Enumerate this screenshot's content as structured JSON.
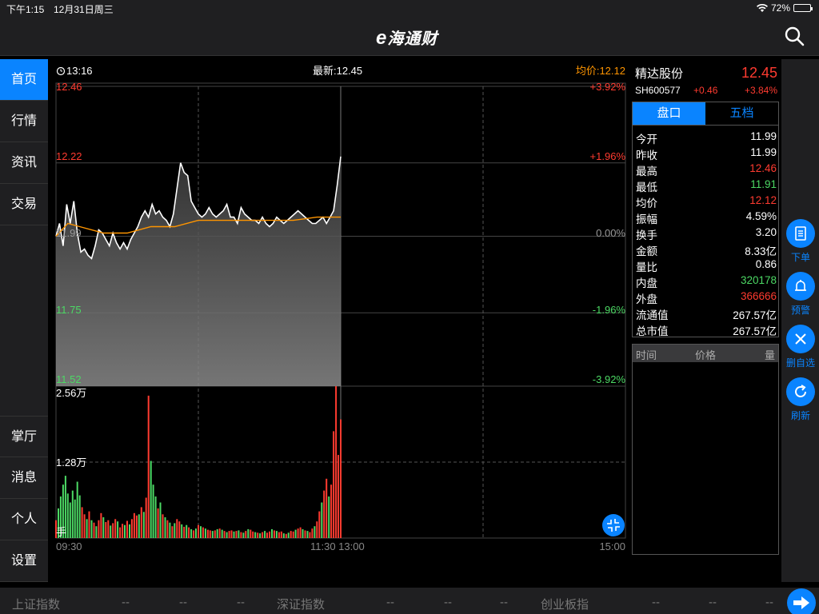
{
  "status_bar": {
    "time": "下午1:15",
    "date": "12月31日周三",
    "battery": "72%",
    "battery_level": 0.72
  },
  "header": {
    "logo_e": "e",
    "logo_text": "海通财"
  },
  "sidebar": {
    "items": [
      {
        "label": "首页",
        "active": true
      },
      {
        "label": "行情"
      },
      {
        "label": "资讯"
      },
      {
        "label": "交易"
      },
      {
        "label": "掌厅"
      },
      {
        "label": "消息"
      },
      {
        "label": "个人"
      },
      {
        "label": "设置"
      }
    ]
  },
  "chart_header": {
    "clock_time": "13:16",
    "latest": "最新:12.45",
    "average": "均价:12.12"
  },
  "chart_data": {
    "type": "line",
    "price_axis_left": [
      "12.46",
      "12.22",
      "11.99",
      "11.75",
      "11.52"
    ],
    "price_axis_right": [
      "+3.92%",
      "+1.96%",
      "0.00%",
      "-1.96%",
      "-3.92%"
    ],
    "price_values": [
      12.46,
      12.22,
      11.99,
      11.75,
      11.52
    ],
    "prev_close": 11.99,
    "volume_axis": [
      "2.56万",
      "1.28万",
      "手"
    ],
    "volume_max": 25600,
    "time_labels": [
      "09:30",
      "11:30 13:00",
      "15:00"
    ],
    "total_minutes": 240,
    "price_series": [
      [
        0,
        11.99
      ],
      [
        3,
        12.03
      ],
      [
        6,
        11.96
      ],
      [
        9,
        12.09
      ],
      [
        12,
        12.03
      ],
      [
        15,
        12.1
      ],
      [
        18,
        12.0
      ],
      [
        21,
        11.94
      ],
      [
        24,
        11.95
      ],
      [
        27,
        11.93
      ],
      [
        30,
        11.92
      ],
      [
        33,
        11.96
      ],
      [
        36,
        12.01
      ],
      [
        39,
        12.0
      ],
      [
        42,
        11.98
      ],
      [
        45,
        11.96
      ],
      [
        48,
        12.0
      ],
      [
        51,
        11.97
      ],
      [
        54,
        11.95
      ],
      [
        57,
        11.97
      ],
      [
        60,
        11.95
      ],
      [
        63,
        11.98
      ],
      [
        66,
        12.0
      ],
      [
        69,
        12.02
      ],
      [
        72,
        12.05
      ],
      [
        75,
        12.07
      ],
      [
        78,
        12.05
      ],
      [
        81,
        12.09
      ],
      [
        84,
        12.06
      ],
      [
        87,
        12.07
      ],
      [
        90,
        12.05
      ],
      [
        93,
        12.04
      ],
      [
        96,
        12.02
      ],
      [
        99,
        12.06
      ],
      [
        102,
        12.14
      ],
      [
        105,
        12.22
      ],
      [
        108,
        12.19
      ],
      [
        111,
        12.18
      ],
      [
        114,
        12.1
      ],
      [
        117,
        12.08
      ],
      [
        120,
        12.06
      ],
      [
        123,
        12.05
      ],
      [
        126,
        12.06
      ],
      [
        129,
        12.08
      ],
      [
        132,
        12.06
      ],
      [
        135,
        12.05
      ],
      [
        138,
        12.06
      ],
      [
        141,
        12.07
      ],
      [
        144,
        12.09
      ],
      [
        147,
        12.05
      ],
      [
        150,
        12.05
      ],
      [
        153,
        12.03
      ],
      [
        156,
        12.08
      ],
      [
        159,
        12.06
      ],
      [
        162,
        12.05
      ],
      [
        165,
        12.04
      ],
      [
        168,
        12.04
      ],
      [
        171,
        12.03
      ],
      [
        174,
        12.05
      ],
      [
        177,
        12.03
      ],
      [
        180,
        12.02
      ],
      [
        183,
        12.03
      ],
      [
        186,
        12.05
      ],
      [
        189,
        12.04
      ],
      [
        192,
        12.03
      ],
      [
        195,
        12.04
      ],
      [
        198,
        12.05
      ],
      [
        201,
        12.06
      ],
      [
        204,
        12.07
      ],
      [
        207,
        12.06
      ],
      [
        210,
        12.05
      ],
      [
        213,
        12.04
      ],
      [
        216,
        12.03
      ],
      [
        219,
        12.03
      ],
      [
        222,
        12.04
      ],
      [
        225,
        12.05
      ],
      [
        228,
        12.03
      ],
      [
        231,
        12.05
      ],
      [
        234,
        12.07
      ],
      [
        237,
        12.15
      ],
      [
        240,
        12.24
      ]
    ],
    "avg_series": [
      [
        0,
        11.99
      ],
      [
        10,
        12.03
      ],
      [
        20,
        12.02
      ],
      [
        40,
        12.0
      ],
      [
        60,
        12.0
      ],
      [
        80,
        12.02
      ],
      [
        100,
        12.02
      ],
      [
        120,
        12.04
      ],
      [
        140,
        12.04
      ],
      [
        160,
        12.04
      ],
      [
        180,
        12.04
      ],
      [
        200,
        12.04
      ],
      [
        220,
        12.05
      ],
      [
        240,
        12.05
      ]
    ],
    "volumes": [
      [
        0,
        3000,
        "r"
      ],
      [
        2,
        5000,
        "g"
      ],
      [
        4,
        7000,
        "g"
      ],
      [
        6,
        9000,
        "g"
      ],
      [
        8,
        10500,
        "g"
      ],
      [
        10,
        7500,
        "g"
      ],
      [
        12,
        6000,
        "g"
      ],
      [
        14,
        8000,
        "g"
      ],
      [
        16,
        6500,
        "g"
      ],
      [
        18,
        9500,
        "g"
      ],
      [
        20,
        7200,
        "g"
      ],
      [
        22,
        5200,
        "r"
      ],
      [
        24,
        4000,
        "r"
      ],
      [
        26,
        3200,
        "g"
      ],
      [
        28,
        4500,
        "r"
      ],
      [
        30,
        3000,
        "g"
      ],
      [
        32,
        2600,
        "r"
      ],
      [
        34,
        2000,
        "g"
      ],
      [
        36,
        3000,
        "r"
      ],
      [
        38,
        4200,
        "r"
      ],
      [
        40,
        3500,
        "g"
      ],
      [
        42,
        2700,
        "r"
      ],
      [
        44,
        3000,
        "r"
      ],
      [
        46,
        2100,
        "g"
      ],
      [
        48,
        2500,
        "r"
      ],
      [
        50,
        3200,
        "r"
      ],
      [
        52,
        2800,
        "g"
      ],
      [
        54,
        1800,
        "r"
      ],
      [
        56,
        2400,
        "r"
      ],
      [
        58,
        2200,
        "g"
      ],
      [
        60,
        2900,
        "r"
      ],
      [
        62,
        2300,
        "g"
      ],
      [
        64,
        3200,
        "r"
      ],
      [
        66,
        4200,
        "r"
      ],
      [
        68,
        3800,
        "r"
      ],
      [
        70,
        4000,
        "g"
      ],
      [
        72,
        5200,
        "r"
      ],
      [
        74,
        4400,
        "g"
      ],
      [
        76,
        6800,
        "r"
      ],
      [
        78,
        24000,
        "r"
      ],
      [
        80,
        13000,
        "g"
      ],
      [
        82,
        9000,
        "g"
      ],
      [
        84,
        7000,
        "g"
      ],
      [
        86,
        5000,
        "r"
      ],
      [
        88,
        6000,
        "g"
      ],
      [
        90,
        4000,
        "r"
      ],
      [
        92,
        3500,
        "g"
      ],
      [
        94,
        3000,
        "r"
      ],
      [
        96,
        2600,
        "g"
      ],
      [
        98,
        2000,
        "r"
      ],
      [
        100,
        2500,
        "g"
      ],
      [
        102,
        3200,
        "r"
      ],
      [
        104,
        2800,
        "r"
      ],
      [
        106,
        2300,
        "g"
      ],
      [
        108,
        1900,
        "r"
      ],
      [
        110,
        2200,
        "g"
      ],
      [
        112,
        1800,
        "r"
      ],
      [
        114,
        1500,
        "g"
      ],
      [
        116,
        1300,
        "r"
      ],
      [
        118,
        1600,
        "g"
      ],
      [
        120,
        2200,
        "r"
      ],
      [
        122,
        2000,
        "g"
      ],
      [
        124,
        1800,
        "r"
      ],
      [
        126,
        1600,
        "g"
      ],
      [
        128,
        1400,
        "r"
      ],
      [
        130,
        1300,
        "r"
      ],
      [
        132,
        1200,
        "g"
      ],
      [
        134,
        1300,
        "r"
      ],
      [
        136,
        1500,
        "g"
      ],
      [
        138,
        1600,
        "r"
      ],
      [
        140,
        1400,
        "g"
      ],
      [
        142,
        1200,
        "r"
      ],
      [
        144,
        1000,
        "g"
      ],
      [
        146,
        1200,
        "r"
      ],
      [
        148,
        1300,
        "r"
      ],
      [
        150,
        1100,
        "g"
      ],
      [
        152,
        1200,
        "r"
      ],
      [
        154,
        1300,
        "g"
      ],
      [
        156,
        1000,
        "r"
      ],
      [
        158,
        900,
        "g"
      ],
      [
        160,
        1200,
        "r"
      ],
      [
        162,
        1500,
        "g"
      ],
      [
        164,
        1400,
        "r"
      ],
      [
        166,
        1100,
        "r"
      ],
      [
        168,
        1000,
        "g"
      ],
      [
        170,
        900,
        "r"
      ],
      [
        172,
        800,
        "g"
      ],
      [
        174,
        1000,
        "r"
      ],
      [
        176,
        1200,
        "g"
      ],
      [
        178,
        900,
        "r"
      ],
      [
        180,
        1100,
        "r"
      ],
      [
        182,
        1500,
        "g"
      ],
      [
        184,
        1300,
        "r"
      ],
      [
        186,
        1200,
        "g"
      ],
      [
        188,
        1000,
        "r"
      ],
      [
        190,
        1100,
        "r"
      ],
      [
        192,
        800,
        "g"
      ],
      [
        194,
        700,
        "r"
      ],
      [
        196,
        900,
        "g"
      ],
      [
        198,
        1200,
        "r"
      ],
      [
        200,
        1100,
        "r"
      ],
      [
        202,
        1400,
        "g"
      ],
      [
        204,
        1600,
        "r"
      ],
      [
        206,
        1800,
        "r"
      ],
      [
        208,
        1500,
        "g"
      ],
      [
        210,
        1300,
        "r"
      ],
      [
        212,
        1200,
        "g"
      ],
      [
        214,
        1000,
        "r"
      ],
      [
        216,
        1600,
        "r"
      ],
      [
        218,
        2000,
        "g"
      ],
      [
        220,
        2800,
        "r"
      ],
      [
        222,
        4500,
        "r"
      ],
      [
        224,
        6000,
        "g"
      ],
      [
        226,
        8000,
        "r"
      ],
      [
        228,
        10000,
        "r"
      ],
      [
        230,
        7000,
        "g"
      ],
      [
        232,
        9000,
        "r"
      ],
      [
        234,
        18000,
        "r"
      ],
      [
        236,
        25600,
        "r"
      ],
      [
        238,
        14000,
        "r"
      ],
      [
        240,
        20000,
        "r"
      ]
    ]
  },
  "stock": {
    "name": "精达股份",
    "price": "12.45",
    "code": "SH600577",
    "change": "+0.46",
    "pct": "+3.84%"
  },
  "tabs": [
    {
      "label": "盘口",
      "active": true
    },
    {
      "label": "五档"
    }
  ],
  "quote_rows": [
    {
      "label": "今开",
      "value": "11.99",
      "color": "#ffffff"
    },
    {
      "label": "昨收",
      "value": "11.99",
      "color": "#ffffff"
    },
    {
      "label": "最高",
      "value": "12.46",
      "color": "#ff3b30"
    },
    {
      "label": "最低",
      "value": "11.91",
      "color": "#4cd964"
    },
    {
      "label": "均价",
      "value": "12.12",
      "color": "#ff3b30"
    },
    {
      "label": "振幅",
      "value": "4.59%",
      "color": "#ffffff"
    },
    {
      "label": "换手",
      "value": "3.20",
      "color": "#ffffff"
    },
    {
      "label": "金额",
      "value": "8.33亿",
      "color": "#ffffff"
    },
    {
      "label": "量比",
      "value": "0.86",
      "color": "#ffffff"
    },
    {
      "label": "内盘",
      "value": "320178",
      "color": "#4cd964"
    },
    {
      "label": "外盘",
      "value": "366666",
      "color": "#ff3b30"
    },
    {
      "label": "流通值",
      "value": "267.57亿",
      "color": "#ffffff"
    },
    {
      "label": "总市值",
      "value": "267.57亿",
      "color": "#ffffff"
    }
  ],
  "trades_header": {
    "time": "时间",
    "price": "价格",
    "volume": "量"
  },
  "actions": [
    {
      "label": "下单",
      "icon": "document-icon"
    },
    {
      "label": "预警",
      "icon": "bell-icon"
    },
    {
      "label": "删自选",
      "icon": "close-icon"
    },
    {
      "label": "刷新",
      "icon": "refresh-icon"
    }
  ],
  "ticker": {
    "sh_label": "上证指数",
    "sz_label": "深证指数",
    "cy_label": "创业板指",
    "dash": "--"
  },
  "colors": {
    "accent": "#0a84ff",
    "up": "#ff3b30",
    "down": "#4cd964",
    "avg_line": "#ff9500"
  }
}
